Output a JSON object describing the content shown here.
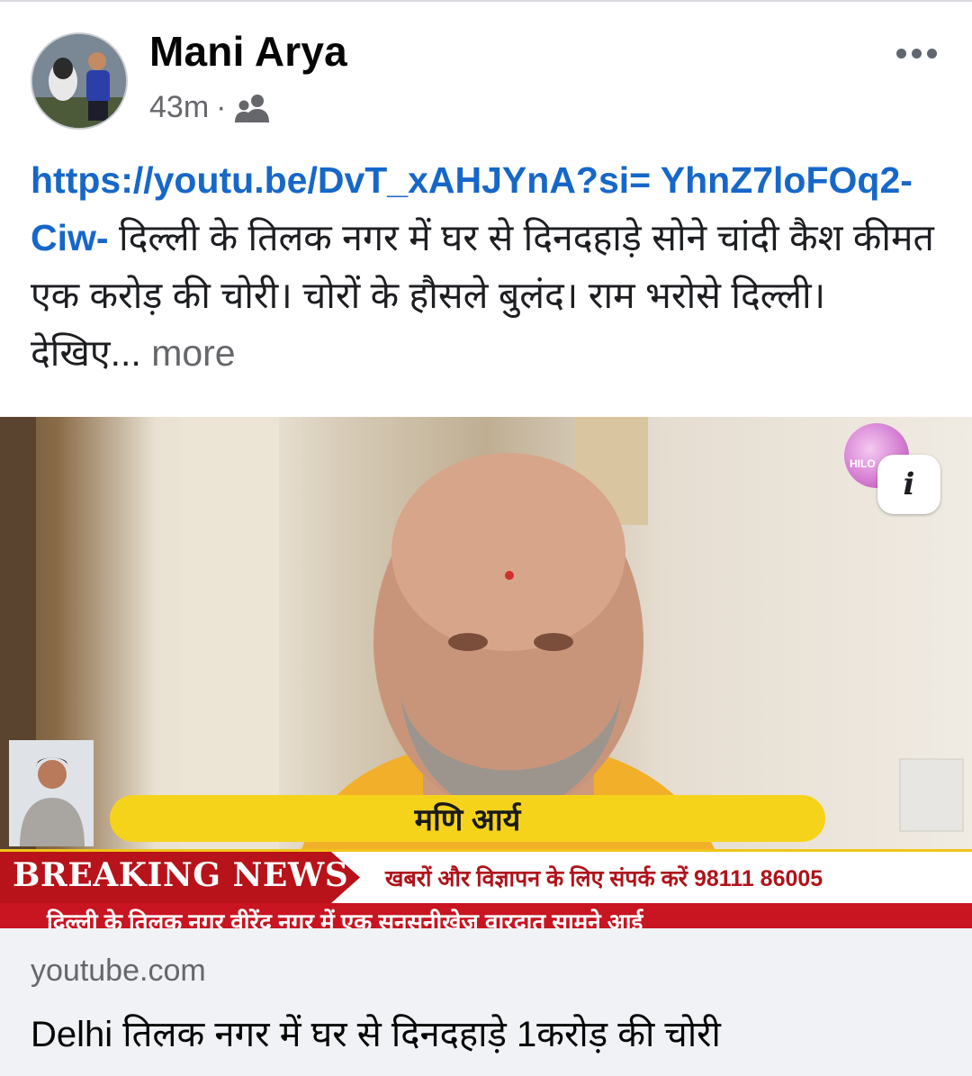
{
  "post": {
    "author": "Mani Arya",
    "time": "43m",
    "separator": "·",
    "audience_icon": "friends-icon",
    "menu_icon": "more-options-icon",
    "link": "https://youtu.be/DvT_xAHJYnA?si= YhnZ7loFOq2-Ciw-",
    "text": " दिल्ली के तिलक नगर में घर से दिनदहाड़े सोने चांदी कैश कीमत एक करोड़ की चोरी। चोरों के हौसले बुलंद। राम भरोसे दिल्ली। देखिए...",
    "see_more": "more"
  },
  "video": {
    "info_label": "i",
    "channel_logo_text": "HILO",
    "nameplate": "मणि आर्य",
    "breaking_label": "BREAKING NEWS",
    "contact_text": "खबरों और विज्ञापन के लिए संपर्क करें 98111 86005",
    "ticker_text": "दिल्ली के तिलक नगर वीरेंद नगर में एक सनसनीखेज वारदात सामने आई"
  },
  "link_card": {
    "domain": "youtube.com",
    "title": "Delhi तिलक नगर में घर से दिनदहाड़े 1करोड़ की चोरी"
  },
  "colors": {
    "link": "#1767c9",
    "breaking_red": "#b8121a",
    "nameplate_yellow": "#f6d31b",
    "card_bg": "#f0f2f5"
  }
}
